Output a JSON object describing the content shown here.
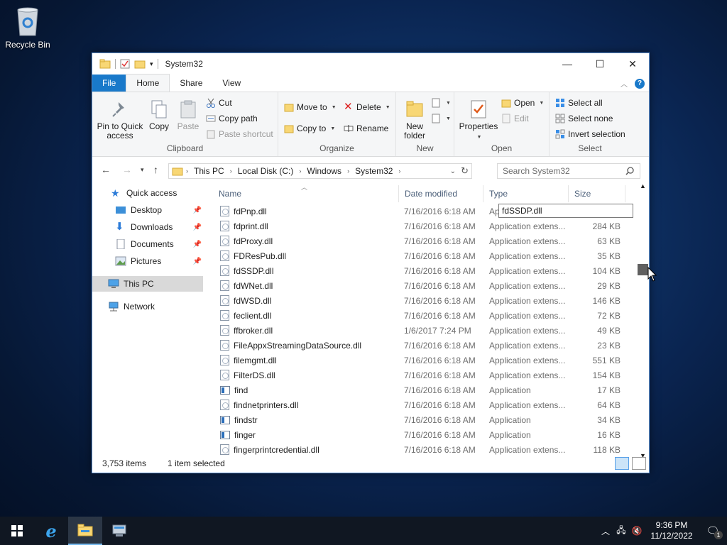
{
  "desktop": {
    "recycle_bin_label": "Recycle Bin"
  },
  "window": {
    "title": "System32",
    "controls": [
      "minimize",
      "maximize",
      "close"
    ]
  },
  "ribbon_tabs": {
    "file": "File",
    "home": "Home",
    "share": "Share",
    "view": "View"
  },
  "ribbon": {
    "clipboard": {
      "name": "Clipboard",
      "pin_to_quick_access": "Pin to Quick access",
      "copy": "Copy",
      "paste": "Paste",
      "cut": "Cut",
      "copy_path": "Copy path",
      "paste_shortcut": "Paste shortcut"
    },
    "organize": {
      "name": "Organize",
      "move_to": "Move to",
      "copy_to": "Copy to",
      "delete": "Delete",
      "rename": "Rename"
    },
    "new": {
      "name": "New",
      "new_folder": "New folder"
    },
    "open": {
      "name": "Open",
      "properties": "Properties",
      "open": "Open",
      "edit": "Edit"
    },
    "select": {
      "name": "Select",
      "select_all": "Select all",
      "select_none": "Select none",
      "invert_selection": "Invert selection"
    }
  },
  "address": {
    "crumbs": [
      "This PC",
      "Local Disk (C:)",
      "Windows",
      "System32"
    ],
    "search_placeholder": "Search System32"
  },
  "nav_pane": {
    "quick_access": "Quick access",
    "desktop": "Desktop",
    "downloads": "Downloads",
    "documents": "Documents",
    "pictures": "Pictures",
    "this_pc": "This PC",
    "network": "Network"
  },
  "columns": {
    "name": "Name",
    "date": "Date modified",
    "type": "Type",
    "size": "Size"
  },
  "files": [
    {
      "name": "fdPnp.dll",
      "date": "7/16/2016 6:18 AM",
      "type": "Ap",
      "size": "",
      "kind": "dll"
    },
    {
      "name": "fdprint.dll",
      "date": "7/16/2016 6:18 AM",
      "type": "Application extens...",
      "size": "284 KB",
      "kind": "dll"
    },
    {
      "name": "fdProxy.dll",
      "date": "7/16/2016 6:18 AM",
      "type": "Application extens...",
      "size": "63 KB",
      "kind": "dll"
    },
    {
      "name": "FDResPub.dll",
      "date": "7/16/2016 6:18 AM",
      "type": "Application extens...",
      "size": "35 KB",
      "kind": "dll"
    },
    {
      "name": "fdSSDP.dll",
      "date": "7/16/2016 6:18 AM",
      "type": "Application extens...",
      "size": "104 KB",
      "kind": "dll"
    },
    {
      "name": "fdWNet.dll",
      "date": "7/16/2016 6:18 AM",
      "type": "Application extens...",
      "size": "29 KB",
      "kind": "dll"
    },
    {
      "name": "fdWSD.dll",
      "date": "7/16/2016 6:18 AM",
      "type": "Application extens...",
      "size": "146 KB",
      "kind": "dll"
    },
    {
      "name": "feclient.dll",
      "date": "7/16/2016 6:18 AM",
      "type": "Application extens...",
      "size": "72 KB",
      "kind": "dll"
    },
    {
      "name": "ffbroker.dll",
      "date": "1/6/2017 7:24 PM",
      "type": "Application extens...",
      "size": "49 KB",
      "kind": "dll"
    },
    {
      "name": "FileAppxStreamingDataSource.dll",
      "date": "7/16/2016 6:18 AM",
      "type": "Application extens...",
      "size": "23 KB",
      "kind": "dll"
    },
    {
      "name": "filemgmt.dll",
      "date": "7/16/2016 6:18 AM",
      "type": "Application extens...",
      "size": "551 KB",
      "kind": "dll"
    },
    {
      "name": "FilterDS.dll",
      "date": "7/16/2016 6:18 AM",
      "type": "Application extens...",
      "size": "154 KB",
      "kind": "dll"
    },
    {
      "name": "find",
      "date": "7/16/2016 6:18 AM",
      "type": "Application",
      "size": "17 KB",
      "kind": "app"
    },
    {
      "name": "findnetprinters.dll",
      "date": "7/16/2016 6:18 AM",
      "type": "Application extens...",
      "size": "64 KB",
      "kind": "dll"
    },
    {
      "name": "findstr",
      "date": "7/16/2016 6:18 AM",
      "type": "Application",
      "size": "34 KB",
      "kind": "app"
    },
    {
      "name": "finger",
      "date": "7/16/2016 6:18 AM",
      "type": "Application",
      "size": "16 KB",
      "kind": "app"
    },
    {
      "name": "fingerprintcredential.dll",
      "date": "7/16/2016 6:18 AM",
      "type": "Application extens...",
      "size": "118 KB",
      "kind": "dll"
    }
  ],
  "rename_box_value": "fdSSDP.dll",
  "status": {
    "item_count": "3,753 items",
    "selected": "1 item selected"
  },
  "taskbar": {
    "time": "9:36 PM",
    "date": "11/12/2022",
    "notification_count": "1"
  },
  "colors": {
    "accent": "#1979ca",
    "desktop": "#0a2450",
    "taskbar": "#101722"
  }
}
